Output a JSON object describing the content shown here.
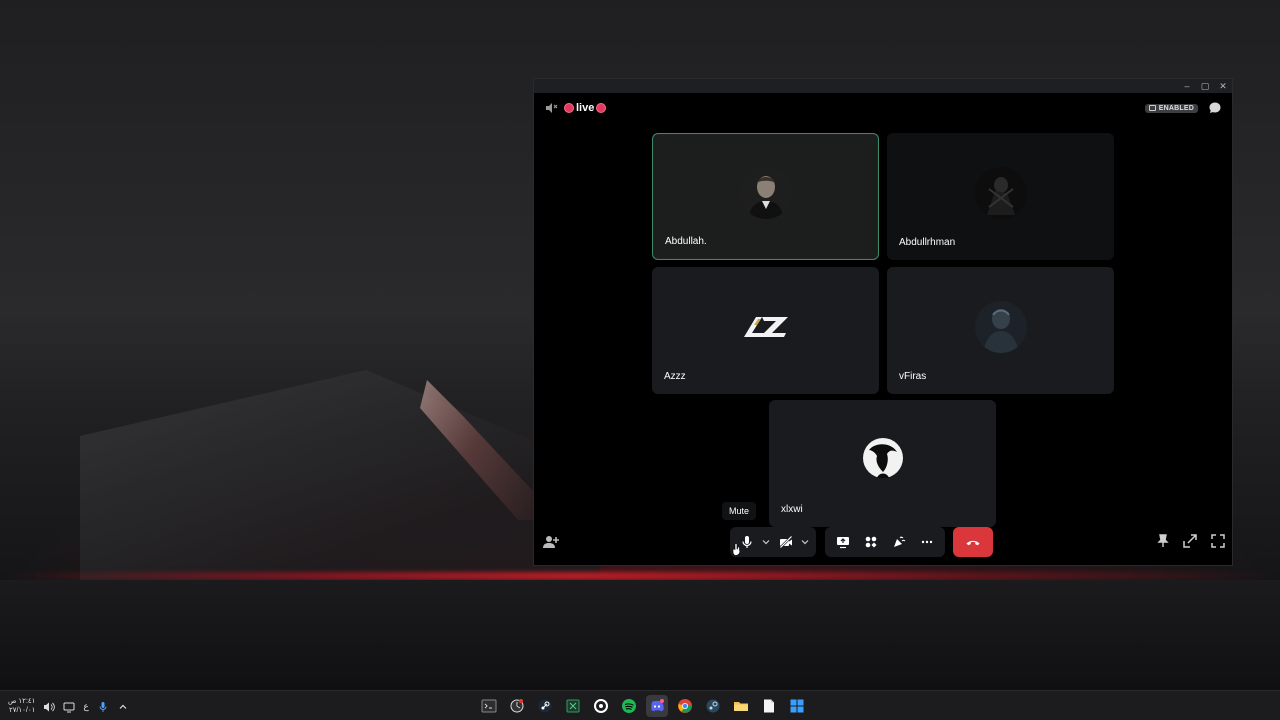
{
  "window": {
    "controls": [
      "minimize",
      "maximize",
      "close"
    ]
  },
  "call": {
    "live_label": "live",
    "badge_label": "ENABLED",
    "participants": [
      {
        "name": "Abdullah.",
        "speaking": true
      },
      {
        "name": "Abdullrhman",
        "speaking": false
      },
      {
        "name": "Azzz",
        "speaking": false
      },
      {
        "name": "vFiras",
        "speaking": false
      },
      {
        "name": "xlxwi",
        "speaking": false
      }
    ],
    "tooltip": "Mute"
  },
  "controls": {
    "mic": "microphone-icon",
    "camera": "camera-off-icon",
    "share": "screen-share-icon",
    "activities": "activities-icon",
    "soundboard": "soundboard-icon",
    "more": "more-icon",
    "disconnect": "end-call-icon"
  },
  "taskbar": {
    "time": "١٢:٤١ ص",
    "date": "٢٧/١٠/٠١",
    "lang": "ع"
  },
  "colors": {
    "accent_live": "#e03a5f",
    "end_call": "#da373c",
    "speaking_border": "#3a8a6a"
  }
}
